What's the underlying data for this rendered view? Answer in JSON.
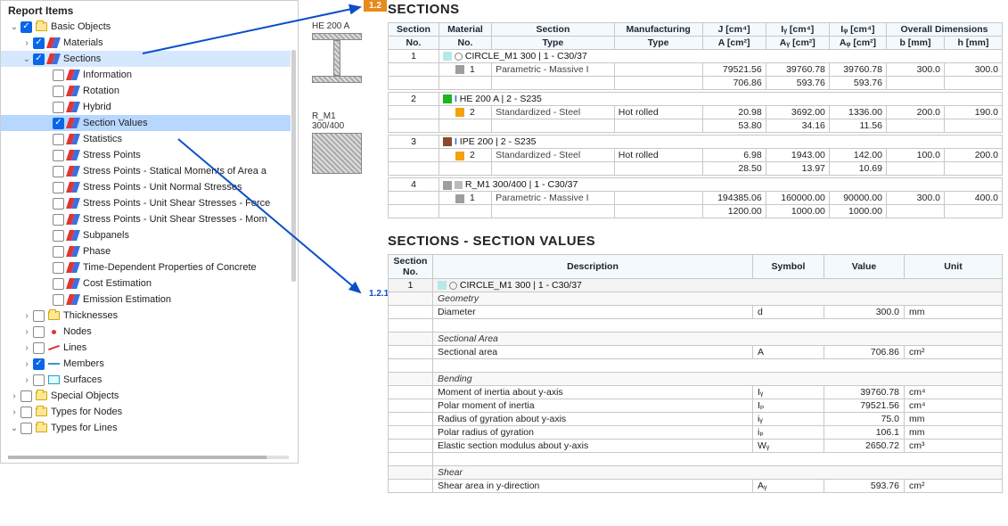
{
  "tree": {
    "title": "Report Items",
    "basic_objects": "Basic Objects",
    "materials": "Materials",
    "sections": "Sections",
    "information": "Information",
    "rotation": "Rotation",
    "hybrid": "Hybrid",
    "section_values": "Section Values",
    "statistics": "Statistics",
    "stress_points": "Stress Points",
    "sp_statical": "Stress Points - Statical Moments of Area a",
    "sp_unit_normal": "Stress Points - Unit Normal Stresses",
    "sp_unit_shear_force": "Stress Points - Unit Shear Stresses - Force",
    "sp_unit_shear_mom": "Stress Points - Unit Shear Stresses - Mom",
    "subpanels": "Subpanels",
    "phase": "Phase",
    "time_dep": "Time-Dependent Properties of Concrete",
    "cost_est": "Cost Estimation",
    "emission": "Emission Estimation",
    "thicknesses": "Thicknesses",
    "nodes": "Nodes",
    "lines": "Lines",
    "members": "Members",
    "surfaces": "Surfaces",
    "special_objects": "Special Objects",
    "types_nodes": "Types for Nodes",
    "types_lines": "Types for Lines"
  },
  "preview": {
    "i_label": "HE 200 A",
    "r_label1": "R_M1",
    "r_label2": "300/400"
  },
  "badges": {
    "orange": "1.2",
    "blue": "1.2.1"
  },
  "sections_title": "SECTIONS",
  "sect_values_title": "SECTIONS - SECTION VALUES",
  "sect_headers": {
    "section_no": "Section",
    "section_no2": "No.",
    "material_no": "Material",
    "material_no2": "No.",
    "section_type": "Section",
    "section_type2": "Type",
    "manuf_type": "Manufacturing",
    "manuf_type2": "Type",
    "J": "J [cm⁴]",
    "A": "A [cm²]",
    "Iy": "Iᵧ [cm⁴]",
    "Ay": "Aᵧ [cm²]",
    "Iz": "Iᵩ [cm⁴]",
    "Az": "Aᵩ [cm²]",
    "overall": "Overall Dimensions",
    "b": "b [mm]",
    "h": "h [mm]"
  },
  "sect_rows": [
    {
      "no": "1",
      "group": "CIRCLE_M1 300 | 1 - C30/37",
      "sw1": "s-cy",
      "sw2": "s-gr",
      "mat": "1",
      "type": "Parametric - Massive I",
      "manuf": "",
      "J": "79521.56",
      "Iy": "39760.78",
      "Iz": "39760.78",
      "b": "300.0",
      "h": "300.0",
      "A": "706.86",
      "Ay": "593.76",
      "Az": "593.76"
    },
    {
      "no": "2",
      "group": "HE 200 A | 2 - S235",
      "sw1": "s-gn",
      "sw2": "s-or",
      "icon": "I",
      "mat": "2",
      "type": "Standardized - Steel",
      "manuf": "Hot rolled",
      "J": "20.98",
      "Iy": "3692.00",
      "Iz": "1336.00",
      "b": "200.0",
      "h": "190.0",
      "A": "53.80",
      "Ay": "34.16",
      "Az": "11.56"
    },
    {
      "no": "3",
      "group": "IPE 200 | 2 - S235",
      "sw1": "s-br",
      "sw2": "s-or",
      "icon": "I",
      "mat": "2",
      "type": "Standardized - Steel",
      "manuf": "Hot rolled",
      "J": "6.98",
      "Iy": "1943.00",
      "Iz": "142.00",
      "b": "100.0",
      "h": "200.0",
      "A": "28.50",
      "Ay": "13.97",
      "Az": "10.69"
    },
    {
      "no": "4",
      "group": "R_M1 300/400 | 1 - C30/37",
      "sw1": "s-gr",
      "sw2": "s-gr",
      "icon": "R",
      "mat": "1",
      "type": "Parametric - Massive I",
      "manuf": "",
      "J": "194385.06",
      "Iy": "160000.00",
      "Iz": "90000.00",
      "b": "300.0",
      "h": "400.0",
      "A": "1200.00",
      "Ay": "1000.00",
      "Az": "1000.00"
    }
  ],
  "sv_headers": {
    "section_no": "Section",
    "no": "No.",
    "desc": "Description",
    "symbol": "Symbol",
    "value": "Value",
    "unit": "Unit"
  },
  "sv": {
    "no": "1",
    "group": "CIRCLE_M1 300 | 1 - C30/37",
    "geometry": "Geometry",
    "diam_lbl": "Diameter",
    "diam_sym": "d",
    "diam_val": "300.0",
    "diam_unit": "mm",
    "sa_hdr": "Sectional Area",
    "sa_lbl": "Sectional area",
    "sa_sym": "A",
    "sa_val": "706.86",
    "sa_unit": "cm²",
    "bend": "Bending",
    "iy_lbl": "Moment of inertia about y-axis",
    "iy_sym": "Iᵧ",
    "iy_val": "39760.78",
    "iy_unit": "cm⁴",
    "ip_lbl": "Polar moment of inertia",
    "ip_sym": "Iₚ",
    "ip_val": "79521.56",
    "ip_unit": "cm⁴",
    "ry_lbl": "Radius of gyration about y-axis",
    "ry_sym": "iᵧ",
    "ry_val": "75.0",
    "ry_unit": "mm",
    "rp_lbl": "Polar radius of gyration",
    "rp_sym": "iₚ",
    "rp_val": "106.1",
    "rp_unit": "mm",
    "wy_lbl": "Elastic section modulus about y-axis",
    "wy_sym": "Wᵧ",
    "wy_val": "2650.72",
    "wy_unit": "cm³",
    "shear": "Shear",
    "ay_lbl": "Shear area in y-direction",
    "ay_sym": "Aᵧ",
    "ay_val": "593.76",
    "ay_unit": "cm²"
  }
}
